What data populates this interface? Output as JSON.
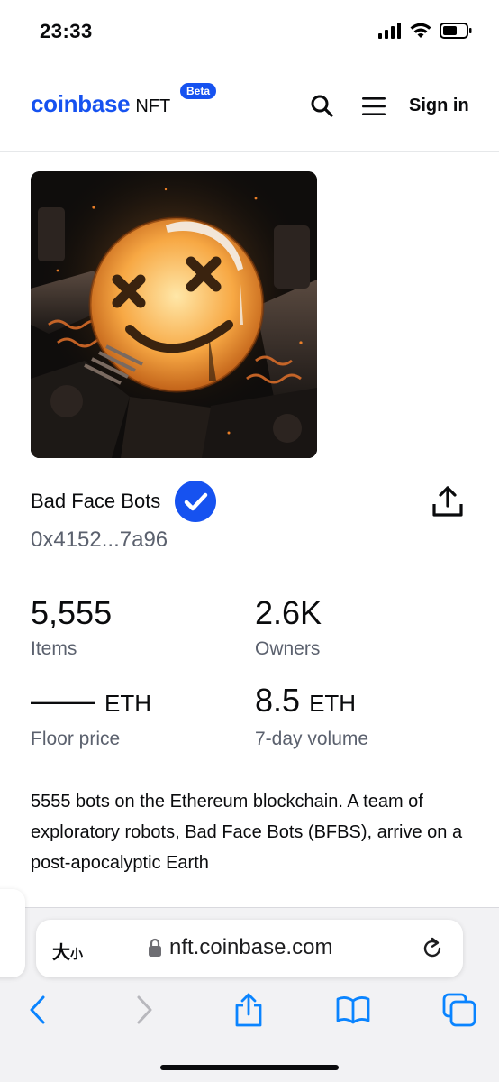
{
  "status_bar": {
    "time": "23:33"
  },
  "header": {
    "brand": "coinbase",
    "product": "NFT",
    "badge": "Beta",
    "sign_in": "Sign in"
  },
  "collection": {
    "name": "Bad Face Bots",
    "address": "0x4152...7a96",
    "verified": true,
    "description": "5555 bots on the Ethereum blockchain. A team of exploratory robots, Bad Face Bots (BFBS), arrive on a post-apocalyptic Earth"
  },
  "stats": {
    "items": {
      "value": "5,555",
      "label": "Items"
    },
    "owners": {
      "value": "2.6K",
      "label": "Owners"
    },
    "floor": {
      "value": "——",
      "unit": "ETH",
      "label": "Floor price"
    },
    "volume": {
      "value": "8.5",
      "unit": "ETH",
      "label": "7-day volume"
    }
  },
  "browser": {
    "text_size": "大",
    "text_size_small": "小",
    "url": "nft.coinbase.com"
  },
  "icons": {
    "search": "search-icon",
    "menu": "menu-icon",
    "verified": "verified-check-icon",
    "share": "share-icon",
    "lock": "lock-icon",
    "reload": "reload-icon",
    "back": "back-icon",
    "forward": "forward-icon",
    "browser_share": "share-icon",
    "bookmarks": "bookmarks-icon",
    "tabs": "tabs-icon"
  },
  "colors": {
    "brand_blue": "#1652f0",
    "muted_text": "#5b616e",
    "ios_blue": "#0a84ff"
  }
}
